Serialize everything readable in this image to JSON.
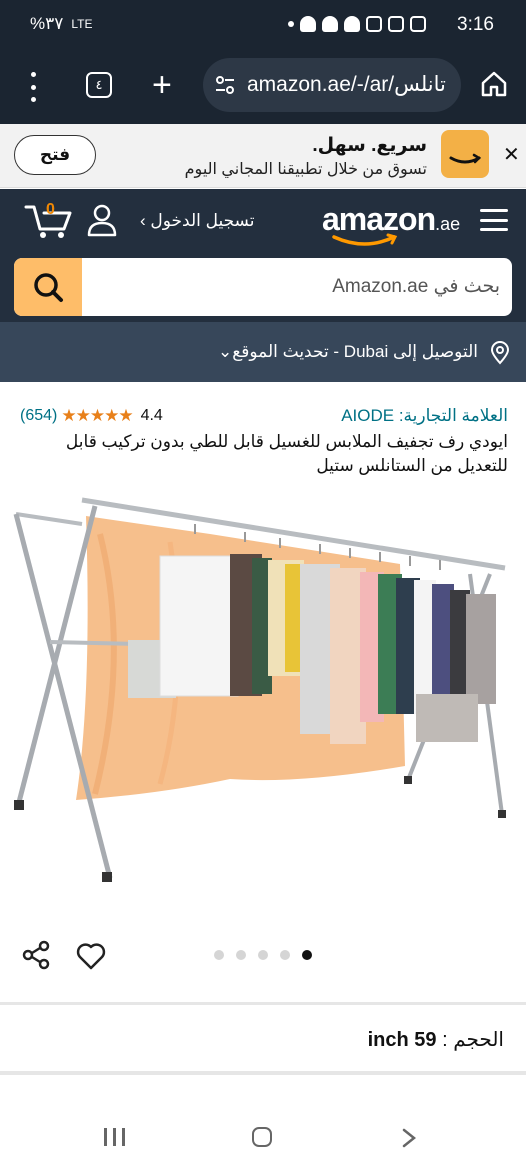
{
  "status_bar": {
    "time": "3:16",
    "battery": "%٣٧",
    "network": "LTE"
  },
  "browser": {
    "tabs_count": "٤",
    "url": "amazon.ae/-/ar/تانلس"
  },
  "app_banner": {
    "title": "سريع. سهل.",
    "subtitle": "تسوق من خلال تطبيقنا المجاني اليوم",
    "open_label": "فتح"
  },
  "header": {
    "logo": "amazon",
    "logo_tld": ".ae",
    "signin_label": "تسجيل الدخول ›",
    "cart_count": "0",
    "search_placeholder": "بحث في Amazon.ae"
  },
  "delivery": {
    "text": "التوصيل إلى Dubai - تحديث الموقع⌄"
  },
  "product": {
    "brand": "العلامة التجارية: AIODE",
    "rating_value": "4.4",
    "rating_count": "(654)",
    "stars": "★★★★★",
    "title": "ايودي رف تجفيف الملابس للغسيل قابل للطي بدون تركيب قابل للتعديل من الستانلس ستيل",
    "image_count": 5,
    "active_image": 5
  },
  "size": {
    "label": "الحجم :",
    "value": "59 inch"
  },
  "colors": {
    "amazon_dark": "#232f3e",
    "search_button": "#febd69",
    "link": "#007185",
    "star": "#e8801a"
  }
}
